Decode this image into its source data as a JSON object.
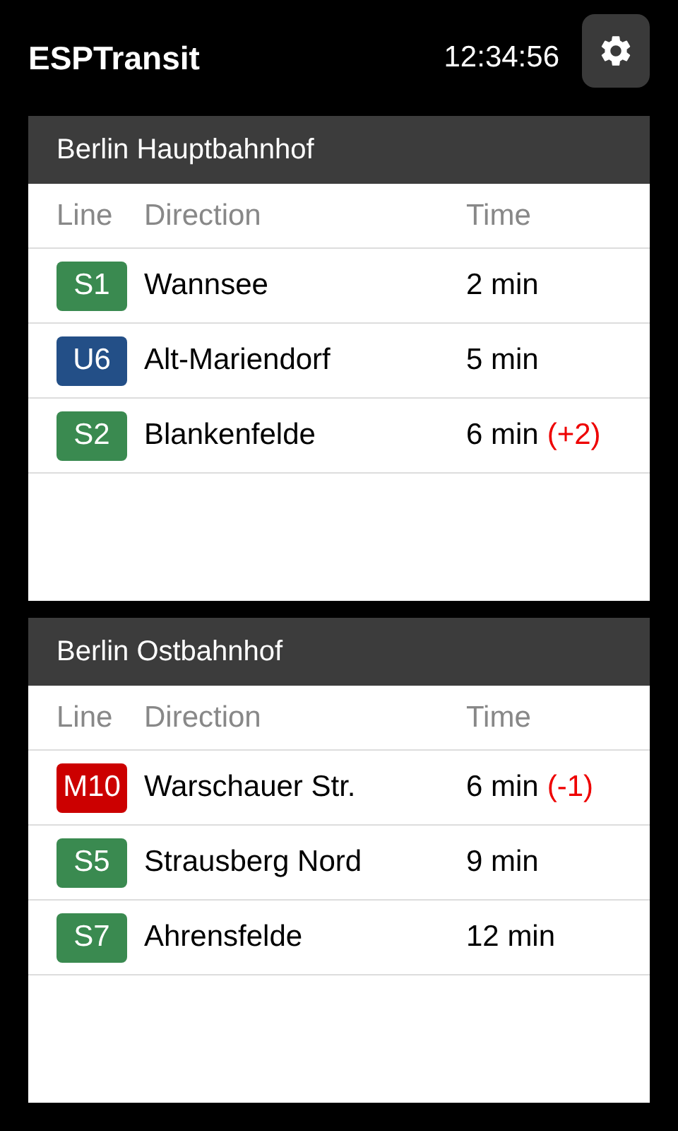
{
  "app": {
    "title": "ESPTransit",
    "clock": "12:34:56"
  },
  "stations": [
    {
      "name": "Berlin Hauptbahnhof",
      "columns": [
        "Line",
        "Direction",
        "Time"
      ],
      "departures": [
        {
          "line": "S1",
          "color": "#3a8a50",
          "direction": "Wannsee",
          "time": "2 min"
        },
        {
          "line": "U6",
          "color": "#234f87",
          "direction": "Alt-Mariendorf",
          "time": "5 min"
        },
        {
          "line": "S2",
          "color": "#3a8a50",
          "direction": "Blankenfelde",
          "time": "6 min",
          "delay": "(+2)"
        }
      ]
    },
    {
      "name": "Berlin Ostbahnhof",
      "columns": [
        "Line",
        "Direction",
        "Time"
      ],
      "departures": [
        {
          "line": "M10",
          "color": "#cc0000",
          "direction": "Warschauer Str.",
          "time": "6 min",
          "delay": "(-1)"
        },
        {
          "line": "S5",
          "color": "#3a8a50",
          "direction": "Strausberg Nord",
          "time": "9 min"
        },
        {
          "line": "S7",
          "color": "#3a8a50",
          "direction": "Ahrensfelde",
          "time": "12 min"
        }
      ]
    }
  ]
}
